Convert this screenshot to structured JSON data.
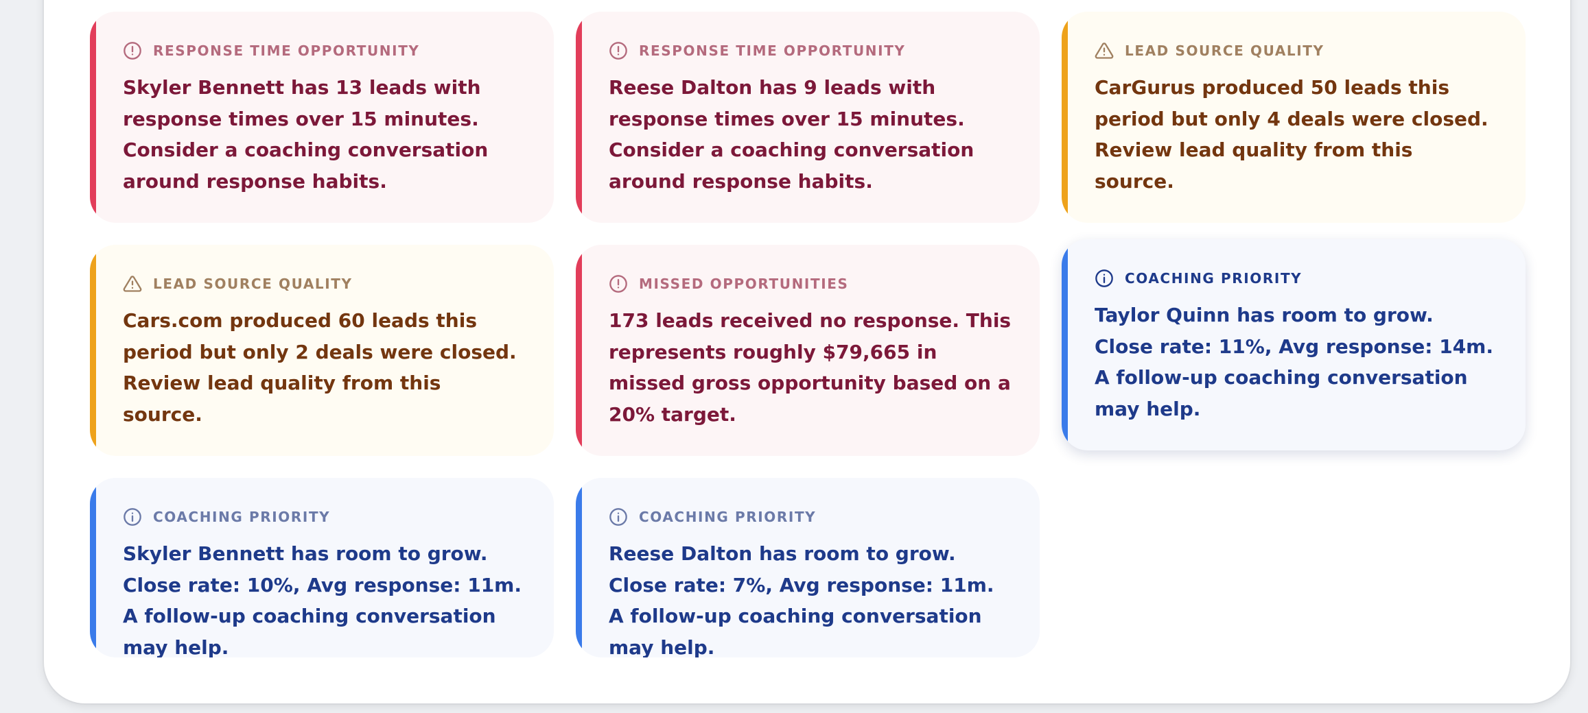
{
  "insights": [
    {
      "category": "RESPONSE TIME OPPORTUNITY",
      "icon": "alert-circle-icon",
      "tone": "danger",
      "message": "Skyler Bennett has 13 leads with response times over 15 minutes. Consider a coaching conversation around response habits."
    },
    {
      "category": "RESPONSE TIME OPPORTUNITY",
      "icon": "alert-circle-icon",
      "tone": "danger",
      "message": "Reese Dalton has 9 leads with response times over 15 minutes. Consider a coaching conversation around response habits."
    },
    {
      "category": "LEAD SOURCE QUALITY",
      "icon": "warning-triangle-icon",
      "tone": "warning",
      "message": "CarGurus produced 50 leads this period but only 4 deals were closed. Review lead quality from this source."
    },
    {
      "category": "LEAD SOURCE QUALITY",
      "icon": "warning-triangle-icon",
      "tone": "warning",
      "message": "Cars.com produced 60 leads this period but only 2 deals were closed. Review lead quality from this source."
    },
    {
      "category": "MISSED OPPORTUNITIES",
      "icon": "alert-circle-icon",
      "tone": "danger",
      "message": "173 leads received no response. This represents roughly $79,665 in missed gross opportunity based on a 20% target."
    },
    {
      "category": "COACHING PRIORITY",
      "icon": "info-circle-icon",
      "tone": "info",
      "message": "Taylor Quinn has room to grow. Close rate: 11%, Avg response: 14m. A follow-up coaching conversation may help."
    },
    {
      "category": "COACHING PRIORITY",
      "icon": "info-circle-icon",
      "tone": "info",
      "message": "Skyler Bennett has room to grow. Close rate: 10%, Avg response: 11m. A follow-up coaching conversation may help."
    },
    {
      "category": "COACHING PRIORITY",
      "icon": "info-circle-icon",
      "tone": "info",
      "message": "Reese Dalton has room to grow. Close rate: 7%, Avg response: 11m. A follow-up coaching conversation may help."
    }
  ],
  "colors": {
    "danger_accent": "#e23d5a",
    "warning_accent": "#eea21b",
    "info_accent": "#3a7bea"
  }
}
